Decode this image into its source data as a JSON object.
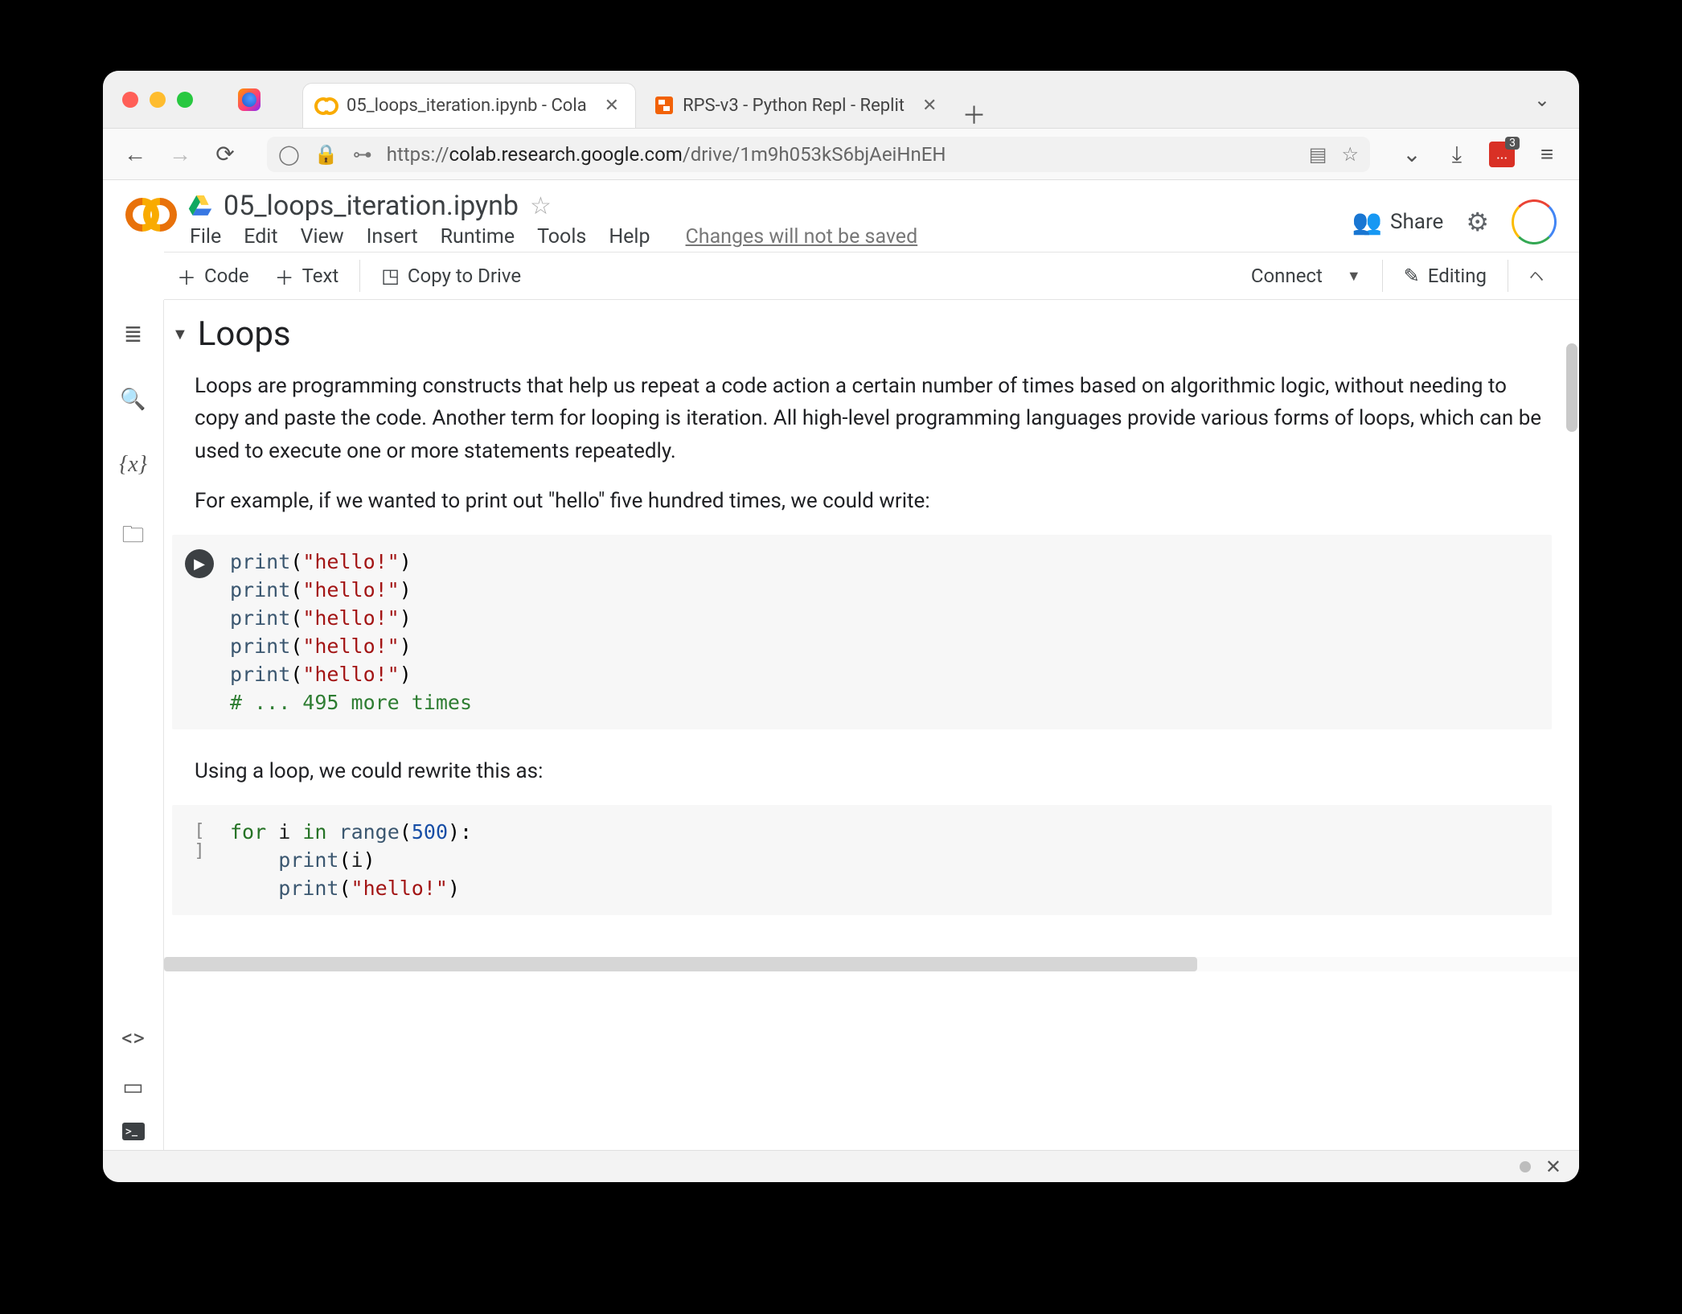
{
  "browser": {
    "tabs": [
      {
        "title": "05_loops_iteration.ipynb - Cola",
        "active": true,
        "favicon": "colab"
      },
      {
        "title": "RPS-v3 - Python Repl - Replit",
        "active": false,
        "favicon": "replit"
      }
    ],
    "url_prefix": "https://",
    "url_domain": "colab.research.google.com",
    "url_path": "/drive/1m9h053kS6bjAeiHnEH",
    "ext_badge": "3"
  },
  "colab": {
    "filename": "05_loops_iteration.ipynb",
    "menus": [
      "File",
      "Edit",
      "View",
      "Insert",
      "Runtime",
      "Tools",
      "Help"
    ],
    "changes_msg": "Changes will not be saved",
    "share_label": "Share",
    "toolbar": {
      "code": "Code",
      "text": "Text",
      "copy_drive": "Copy to Drive",
      "connect": "Connect",
      "editing": "Editing"
    }
  },
  "notebook": {
    "heading": "Loops",
    "para1": "Loops are programming constructs that help us repeat a code action a certain number of times based on algorithmic logic, without needing to copy and paste the code. Another term for looping is iteration. All high-level programming languages provide various forms of loops, which can be used to execute one or more statements repeatedly.",
    "para2": "For example, if we wanted to print out \"hello\" five hundred times, we could write:",
    "cell1": {
      "lines": [
        "print(\"hello!\")",
        "print(\"hello!\")",
        "print(\"hello!\")",
        "print(\"hello!\")",
        "print(\"hello!\")",
        "# ... 495 more times"
      ]
    },
    "para3": "Using a loop, we could rewrite this as:",
    "cell2": {
      "prompt": "[ ]",
      "lines": [
        "for i in range(500):",
        "    print(i)",
        "    print(\"hello!\")"
      ]
    }
  }
}
